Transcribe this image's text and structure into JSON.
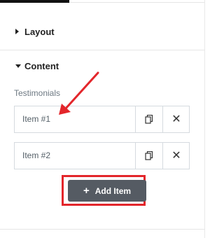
{
  "sections": {
    "layout": {
      "title": "Layout",
      "expanded": false
    },
    "content": {
      "title": "Content",
      "expanded": true
    }
  },
  "repeater": {
    "label": "Testimonials",
    "items": [
      {
        "title": "Item #1"
      },
      {
        "title": "Item #2"
      }
    ],
    "add_button_label": "Add Item",
    "add_button_icon": "plus-icon"
  },
  "annotation": {
    "arrow_color": "#e3262b",
    "highlight_color": "#e3262b"
  },
  "colors": {
    "button_background": "#555b63",
    "active_tab_indicator": "#111111"
  }
}
